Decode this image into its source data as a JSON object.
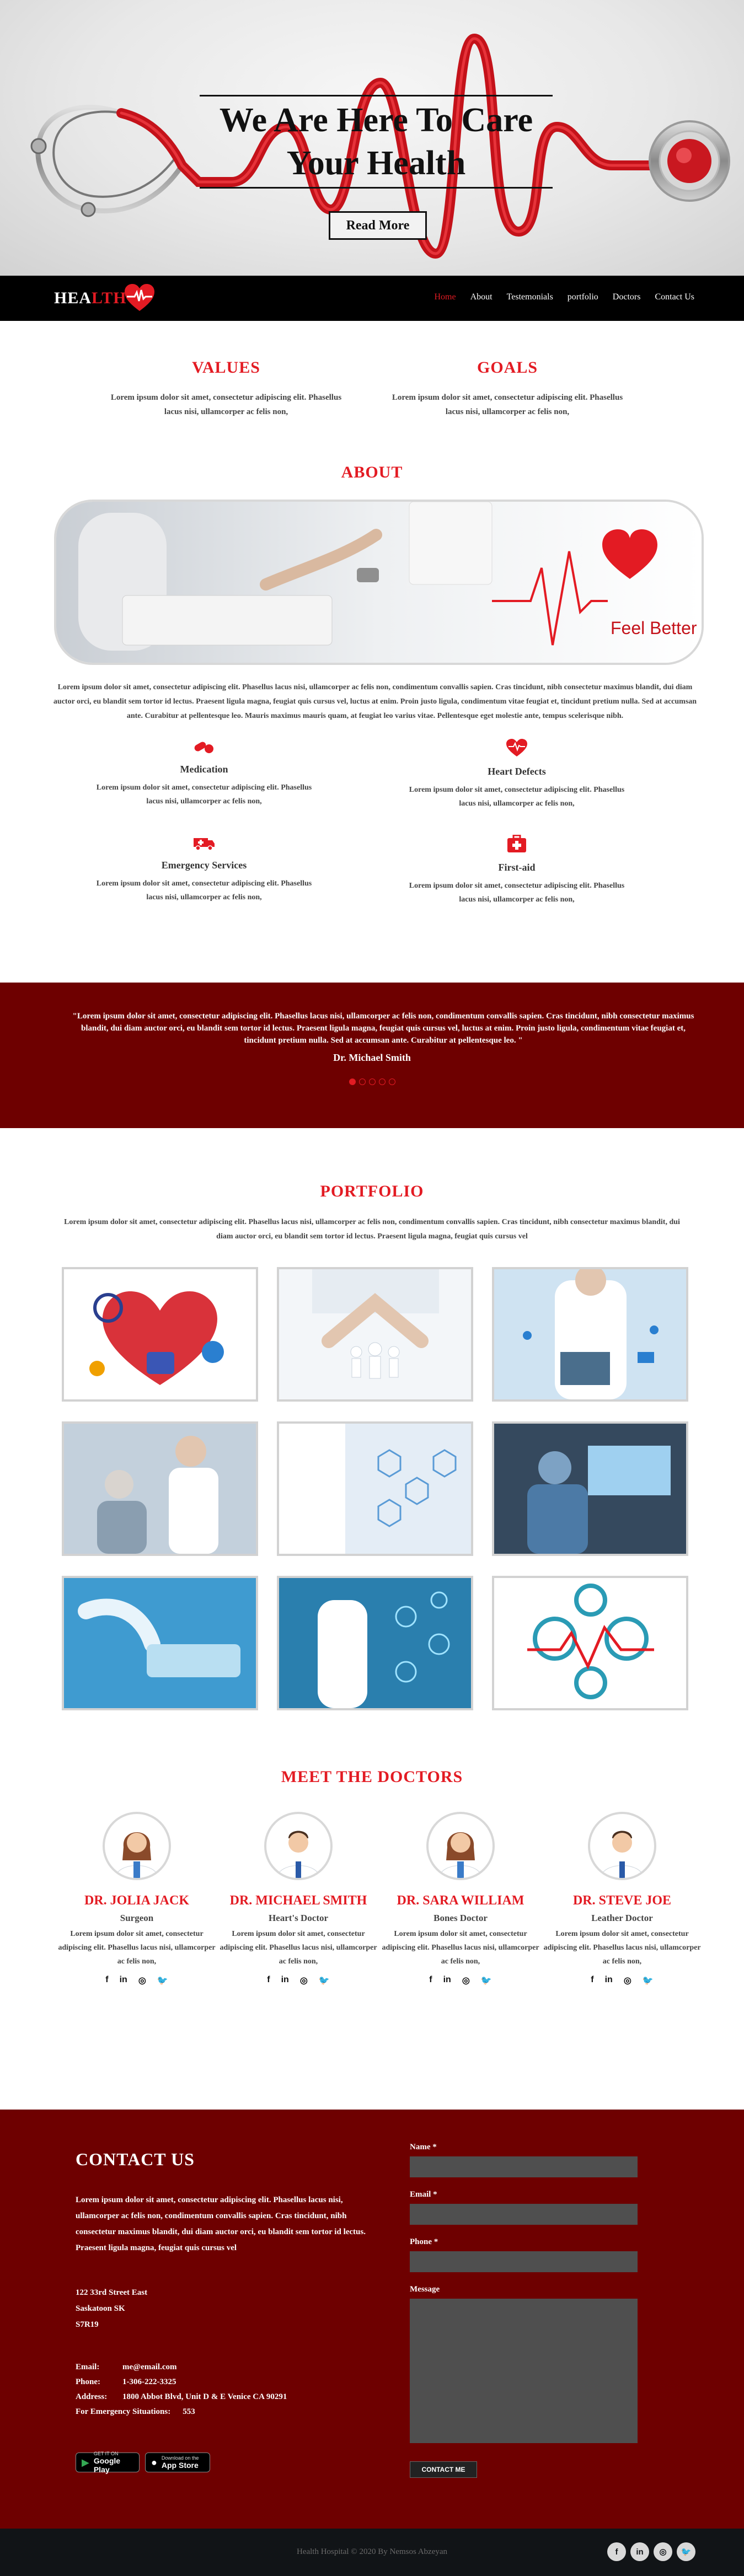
{
  "hero": {
    "title_line1": "We Are Here To Care",
    "title_line2": "Your Health",
    "read_more": "Read More"
  },
  "nav": {
    "logo_part1": "HEA",
    "logo_part2": "LTH",
    "links": [
      "Home",
      "About",
      "Testemonials",
      "portfolio",
      "Doctors",
      "Contact Us"
    ],
    "active": "Home"
  },
  "values": {
    "title": "VALUES",
    "text": "Lorem ipsum dolor sit amet, consectetur adipiscing elit. Phasellus lacus nisi, ullamcorper ac felis non,"
  },
  "goals": {
    "title": "GOALS",
    "text": "Lorem ipsum dolor sit amet, consectetur adipiscing elit. Phasellus lacus nisi, ullamcorper ac felis non,"
  },
  "about": {
    "title": "ABOUT",
    "banner_caption": "Feel Better",
    "text": "Lorem ipsum dolor sit amet, consectetur adipiscing elit. Phasellus lacus nisi, ullamcorper ac felis non, condimentum convallis sapien. Cras tincidunt, nibh consectetur maximus blandit, dui diam auctor orci, eu blandit sem tortor id lectus. Praesent ligula magna, feugiat quis cursus vel, luctus at enim. Proin justo ligula, condimentum vitae feugiat et, tincidunt pretium nulla. Sed at accumsan ante. Curabitur at pellentesque leo. Mauris maximus mauris quam, at feugiat leo varius vitae. Pellentesque eget molestie ante, tempus scelerisque nibh.",
    "services": [
      {
        "title": "Medication",
        "icon": "pills-icon",
        "text": "Lorem ipsum dolor sit amet, consectetur adipiscing elit. Phasellus lacus nisi, ullamcorper ac felis non,"
      },
      {
        "title": "Heart Defects",
        "icon": "heartbeat-icon",
        "text": "Lorem ipsum dolor sit amet, consectetur adipiscing elit. Phasellus lacus nisi, ullamcorper ac felis non,"
      },
      {
        "title": "Emergency Services",
        "icon": "ambulance-icon",
        "text": "Lorem ipsum dolor sit amet, consectetur adipiscing elit. Phasellus lacus nisi, ullamcorper ac felis non,"
      },
      {
        "title": "First-aid",
        "icon": "first-aid-kit-icon",
        "text": "Lorem ipsum dolor sit amet, consectetur adipiscing elit. Phasellus lacus nisi, ullamcorper ac felis non,"
      }
    ]
  },
  "testimonial": {
    "quote": "\"Lorem ipsum dolor sit amet, consectetur adipiscing elit. Phasellus lacus nisi, ullamcorper ac felis non, condimentum convallis sapien. Cras tincidunt, nibh consectetur maximus blandit, dui diam auctor orci, eu blandit sem tortor id lectus. Praesent ligula magna, feugiat quis cursus vel, luctus at enim. Proin justo ligula, condimentum vitae feugiat et, tincidunt pretium nulla. Sed at accumsan ante. Curabitur at pellentesque leo. \"",
    "author": "Dr. Michael Smith",
    "slides": 5,
    "active_slide": 1
  },
  "portfolio": {
    "title": "PORTFOLIO",
    "intro": "Lorem ipsum dolor sit amet, consectetur adipiscing elit. Phasellus lacus nisi, ullamcorper ac felis non, condimentum convallis sapien. Cras tincidunt, nibh consectetur maximus blandit, dui diam auctor orci, eu blandit sem tortor id lectus. Praesent ligula magna, feugiat quis cursus vel"
  },
  "doctors": {
    "title": "MEET THE DOCTORS",
    "list": [
      {
        "name": "DR. JOLIA JACK",
        "role": "Surgeon",
        "text": "Lorem ipsum dolor sit amet, consectetur adipiscing elit. Phasellus lacus nisi, ullamcorper ac felis non,"
      },
      {
        "name": "DR. MICHAEL SMITH",
        "role": "Heart's Doctor",
        "text": "Lorem ipsum dolor sit amet, consectetur adipiscing elit. Phasellus lacus nisi, ullamcorper ac felis non,"
      },
      {
        "name": "DR. SARA WILLIAM",
        "role": "Bones Doctor",
        "text": "Lorem ipsum dolor sit amet, consectetur adipiscing elit. Phasellus lacus nisi, ullamcorper ac felis non,"
      },
      {
        "name": "DR. STEVE JOE",
        "role": "Leather Doctor",
        "text": "Lorem ipsum dolor sit amet, consectetur adipiscing elit. Phasellus lacus nisi, ullamcorper ac felis non,"
      }
    ],
    "social_glyphs": {
      "facebook": "f",
      "linkedin": "in",
      "instagram": "◎",
      "twitter": "🐦"
    }
  },
  "contact": {
    "title": "CONTACT US",
    "text": "Lorem ipsum dolor sit amet, consectetur adipiscing elit. Phasellus lacus nisi, ullamcorper ac felis non, condimentum convallis sapien. Cras tincidunt, nibh consectetur maximus blandit, dui diam auctor orci, eu blandit sem tortor id lectus. Praesent ligula magna, feugiat quis cursus vel",
    "address_lines": [
      "122 33rd Street East",
      "Saskatoon SK",
      "S7R19"
    ],
    "email_label": "Email:",
    "email": "me@email.com",
    "phone_label": "Phone:",
    "phone": "1-306-222-3325",
    "address_label": "Address:",
    "address": "1800 Abbot Blvd, Unit D & E Venice CA 90291",
    "emergency_label": "For Emergency Situations:",
    "emergency": "553",
    "google_play_small": "GET IT ON",
    "google_play": "Google Play",
    "app_store_small": "Download on the",
    "app_store": "App Store",
    "form": {
      "name_label": "Name *",
      "email_label": "Email *",
      "phone_label": "Phone *",
      "message_label": "Message",
      "button": "CONTACT ME"
    }
  },
  "footer": {
    "copyright": "Health Hospital © 2020 By Nemsos Abzeyan"
  },
  "colors": {
    "accent": "#e31b23",
    "maroon": "#6e0000",
    "nav_bg": "#000000"
  }
}
